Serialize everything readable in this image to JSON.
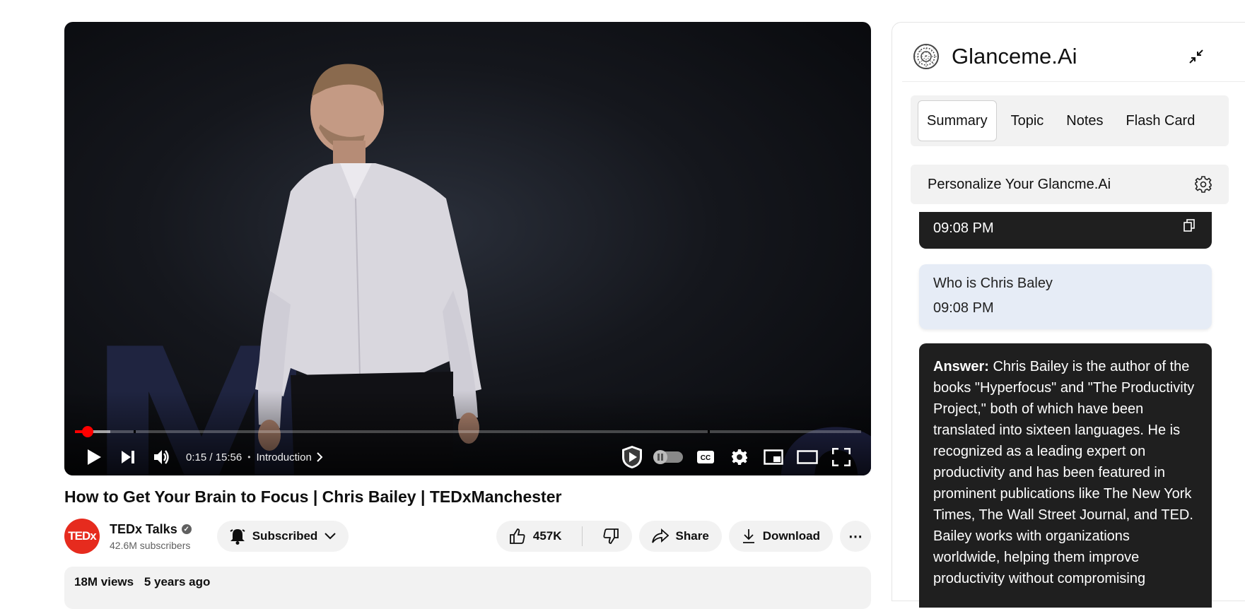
{
  "video": {
    "current_time": "0:15",
    "duration": "15:56",
    "time_text": "0:15 / 15:56",
    "chapter": "Introduction",
    "progress_fraction": 0.016,
    "stage_text": "M",
    "stage_text_2": "o"
  },
  "meta": {
    "title": "How to Get Your Brain to Focus | Chris Bailey | TEDxManchester",
    "channel_name": "TEDx Talks",
    "channel_avatar_text": "TEDx",
    "subscribers": "42.6M subscribers",
    "subscribe_label": "Subscribed",
    "likes": "457K",
    "share_label": "Share",
    "download_label": "Download",
    "views": "18M views",
    "uploaded": "5 years ago"
  },
  "panel": {
    "brand": "Glanceme.Ai",
    "tabs": [
      {
        "label": "Summary",
        "active": true
      },
      {
        "label": "Topic",
        "active": false
      },
      {
        "label": "Notes",
        "active": false
      },
      {
        "label": "Flash Card",
        "active": false
      }
    ],
    "personalize_label": "Personalize Your Glancme.Ai",
    "messages": {
      "previous_time": "09:08 PM",
      "question_text": "Who is Chris Baley",
      "question_time": "09:08 PM",
      "answer_prefix": "Answer:",
      "answer_text": "Chris Bailey is the author of the books \"Hyperfocus\" and \"The Productivity Project,\" both of which have been translated into sixteen languages. He is recognized as a leading expert on productivity and has been featured in prominent publications like The New York Times, The Wall Street Journal, and TED. Bailey works with organizations worldwide, helping them improve productivity without compromising"
    }
  },
  "colors": {
    "progress_red": "#ff0000",
    "answer_bg": "#1f1f1f",
    "question_bg": "#e6ecf6",
    "tedx_red": "#e62b1e"
  }
}
